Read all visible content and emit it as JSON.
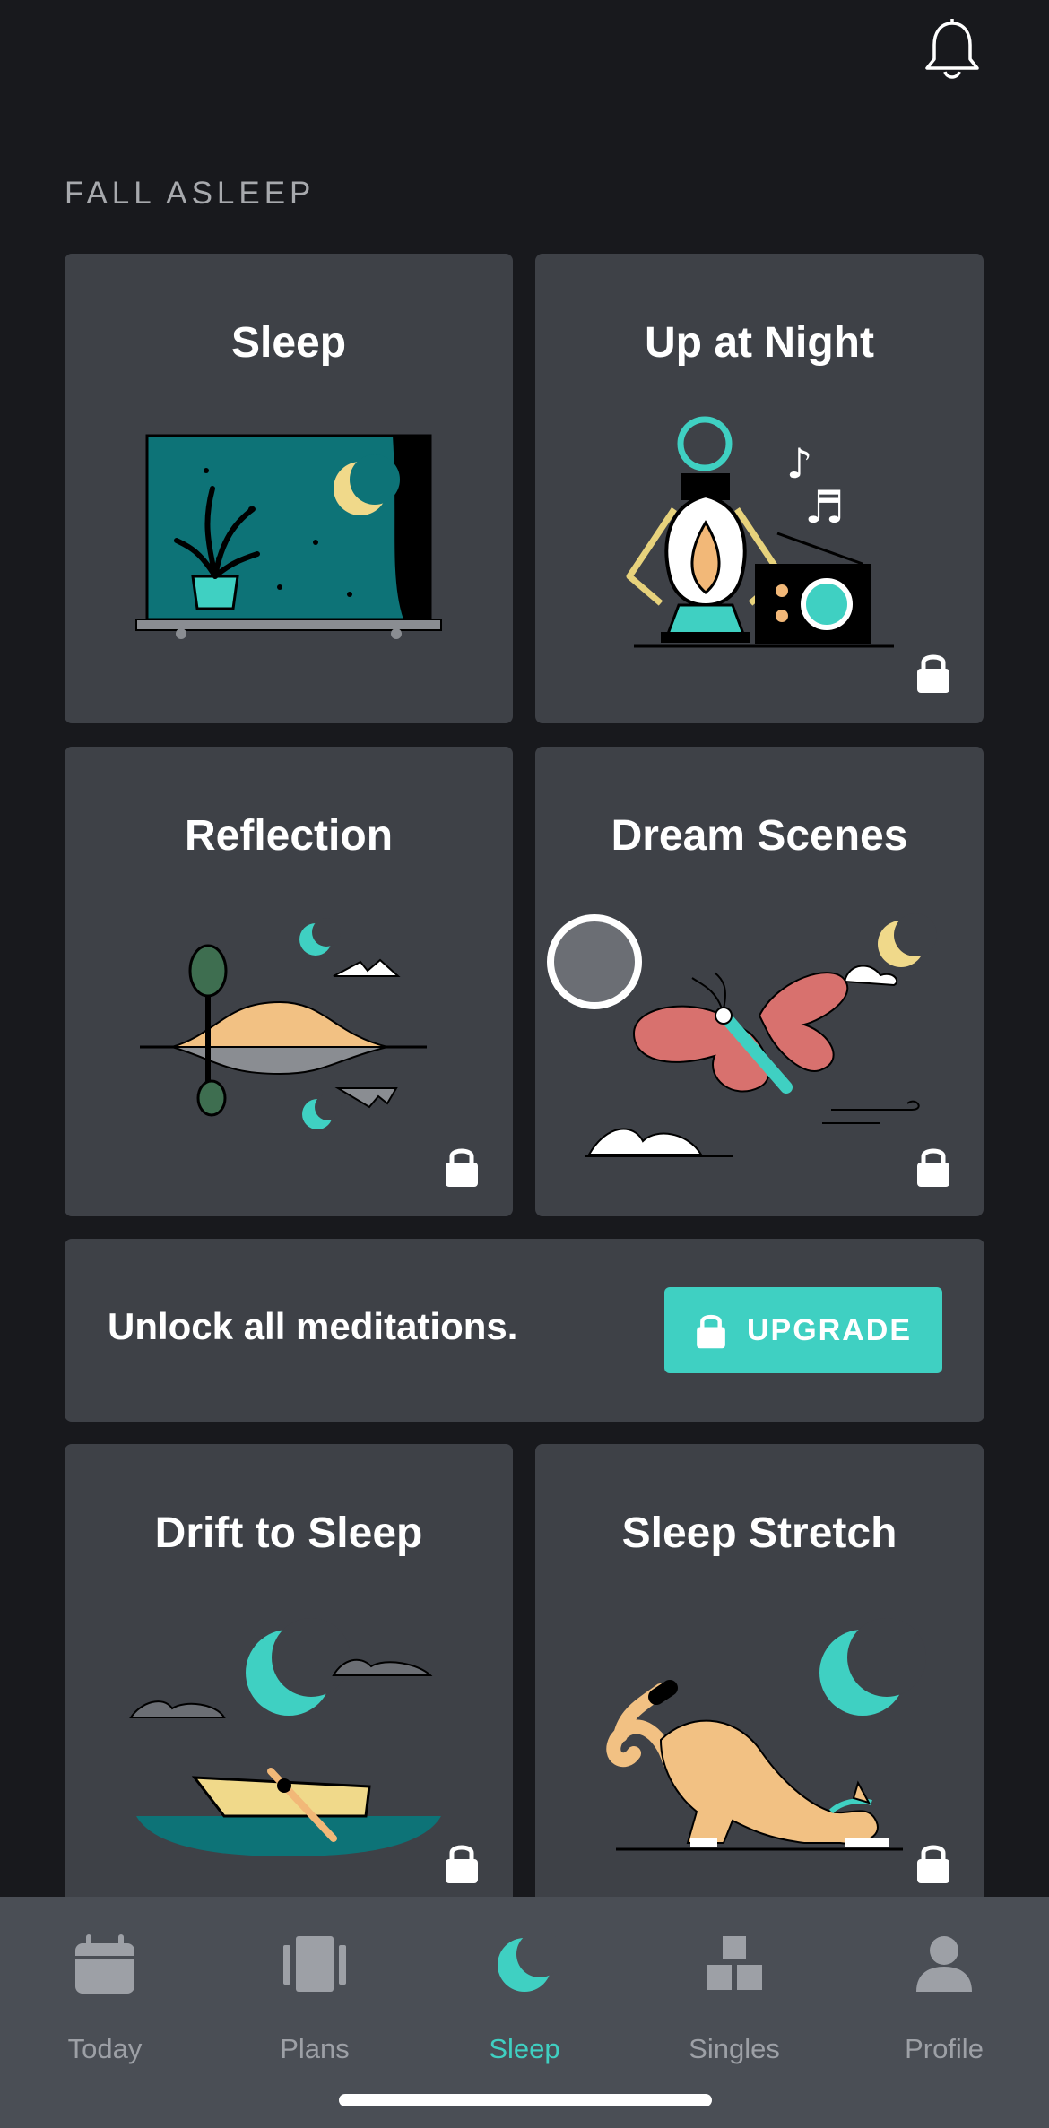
{
  "header": {
    "notifications_icon": "bell-icon"
  },
  "section": {
    "title": "FALL ASLEEP"
  },
  "cards": [
    {
      "title": "Sleep",
      "locked": false
    },
    {
      "title": "Up at Night",
      "locked": true
    },
    {
      "title": "Reflection",
      "locked": true
    },
    {
      "title": "Dream Scenes",
      "locked": true
    },
    {
      "title": "Drift to Sleep",
      "locked": true
    },
    {
      "title": "Sleep Stretch",
      "locked": true
    }
  ],
  "banner": {
    "text": "Unlock all meditations.",
    "button_label": "UPGRADE",
    "button_icon": "lock-icon"
  },
  "tabs": [
    {
      "label": "Today",
      "icon": "calendar-icon",
      "active": false
    },
    {
      "label": "Plans",
      "icon": "plans-icon",
      "active": false
    },
    {
      "label": "Sleep",
      "icon": "moon-icon",
      "active": true
    },
    {
      "label": "Singles",
      "icon": "blocks-icon",
      "active": false
    },
    {
      "label": "Profile",
      "icon": "person-icon",
      "active": false
    }
  ],
  "colors": {
    "background": "#18191d",
    "card": "#3e4147",
    "accent": "#3fd0c2",
    "tabbar": "#4a4e55",
    "muted_text": "#9da0a6"
  }
}
